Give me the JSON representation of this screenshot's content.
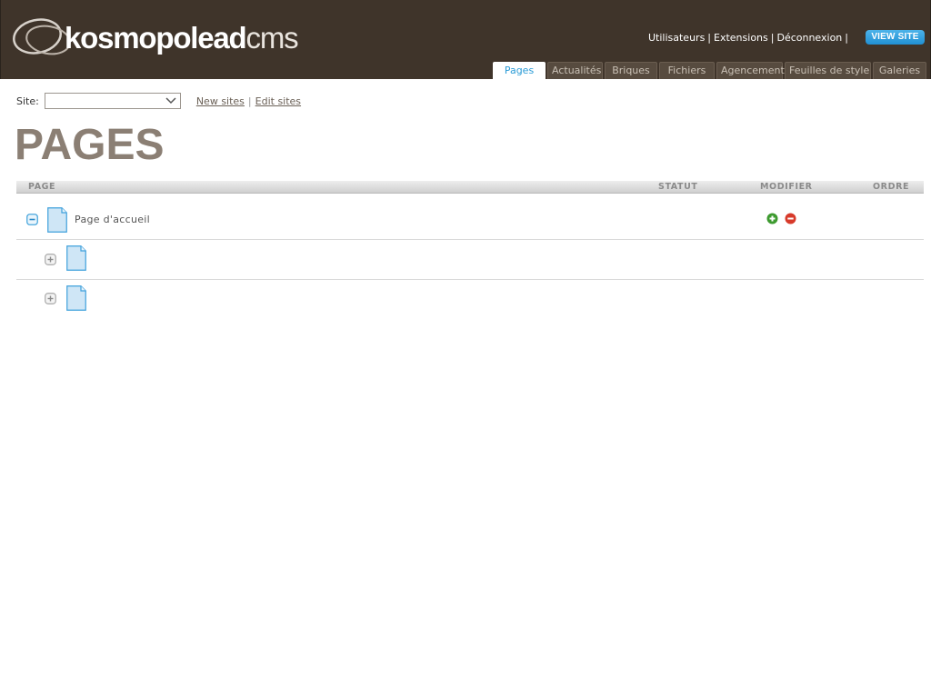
{
  "header": {
    "logo_bold": "kosmopolead",
    "logo_light": "cms",
    "links": [
      "Utilisateurs",
      "Extensions",
      "Déconnexion"
    ],
    "view_site": "VIEW SITE",
    "tabs": [
      {
        "label": "Pages",
        "active": true
      },
      {
        "label": "Actualités",
        "active": false
      },
      {
        "label": "Briques",
        "active": false
      },
      {
        "label": "Fichiers",
        "active": false
      },
      {
        "label": "Agencement",
        "active": false
      },
      {
        "label": "Feuilles de style",
        "active": false
      },
      {
        "label": "Galeries",
        "active": false
      }
    ]
  },
  "site_selector": {
    "label": "Site:",
    "value": "",
    "new_sites": "New sites",
    "edit_sites": "Edit sites"
  },
  "page_title": "PAGES",
  "table": {
    "columns": {
      "page": "PAGE",
      "statut": "STATUT",
      "modifier": "MODIFIER",
      "ordre": "ORDRE"
    },
    "rows": [
      {
        "title": "Page d'accueil",
        "expanded": true,
        "level": 0
      },
      {
        "title": "",
        "expanded": false,
        "level": 1
      },
      {
        "title": "",
        "expanded": false,
        "level": 1
      }
    ]
  },
  "colors": {
    "header_bg": "#3f342a",
    "accent": "#2a9bd6",
    "title": "#8b7f74",
    "add_icon": "#3d9a2f",
    "remove_icon": "#d73a2a"
  },
  "icons": {
    "collapse": "minus-square-icon",
    "expand": "plus-square-icon",
    "document": "document-icon",
    "add": "add-circle-icon",
    "remove": "remove-circle-icon",
    "dropdown": "chevron-down-icon"
  }
}
